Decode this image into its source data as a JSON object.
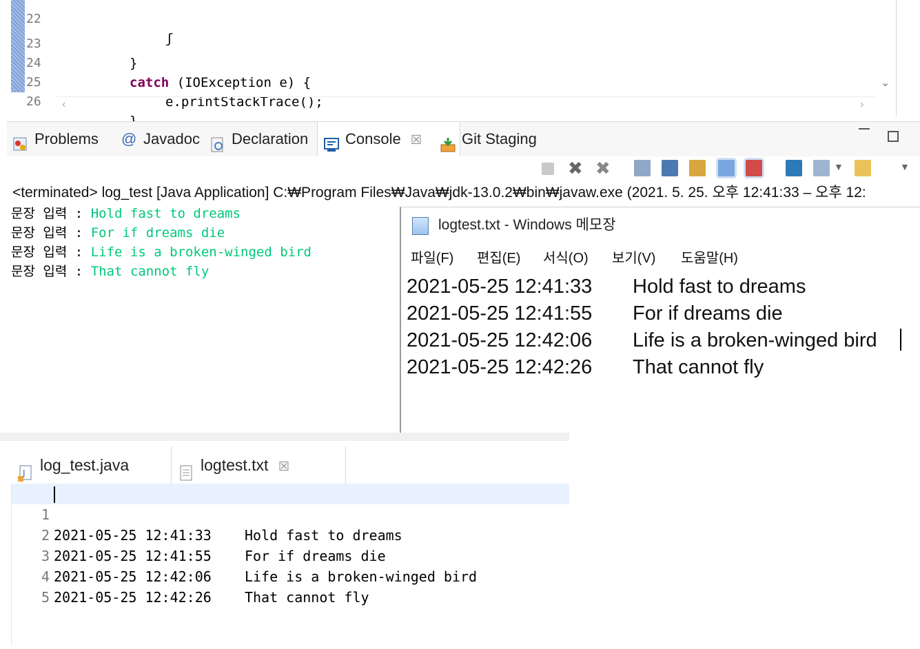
{
  "code_editor": {
    "lines": [
      {
        "num": "22",
        "text": "        }"
      },
      {
        "num": "23",
        "text": "        }"
      },
      {
        "num": "24",
        "kw": "catch",
        "rest": " (IOException e) {"
      },
      {
        "num": "25",
        "text": "            e.printStackTrace();"
      },
      {
        "num": "26",
        "text": "        }"
      }
    ]
  },
  "view_tabs": [
    {
      "label": "Problems",
      "icon": "problems-icon"
    },
    {
      "label": "Javadoc",
      "icon": "javadoc-icon"
    },
    {
      "label": "Declaration",
      "icon": "declaration-icon"
    },
    {
      "label": "Console",
      "icon": "console-icon",
      "active": true,
      "close": "☒"
    },
    {
      "label": "Git Staging",
      "icon": "git-staging-icon"
    }
  ],
  "console": {
    "status": "<terminated> log_test [Java Application] C:₩Program Files₩Java₩jdk-13.0.2₩bin₩javaw.exe  (2021. 5. 25. 오후 12:41:33 – 오후 12:",
    "prompt": "문장 입력 : ",
    "inputs": [
      "Hold fast to dreams",
      "For if dreams die",
      "Life is a broken-winged bird",
      "That cannot fly"
    ]
  },
  "notepad": {
    "title": "logtest.txt - Windows 메모장",
    "menu": [
      "파일(F)",
      "편집(E)",
      "서식(O)",
      "보기(V)",
      "도움말(H)"
    ],
    "lines": [
      {
        "ts": "2021-05-25 12:41:33",
        "text": "Hold fast to dreams"
      },
      {
        "ts": "2021-05-25 12:41:55",
        "text": "For if dreams die"
      },
      {
        "ts": "2021-05-25 12:42:06",
        "text": "Life is a broken-winged bird"
      },
      {
        "ts": "2021-05-25 12:42:26",
        "text": "That cannot fly"
      }
    ]
  },
  "editor_tabs": [
    {
      "label": "log_test.java",
      "icon": "java-file-icon"
    },
    {
      "label": "logtest.txt",
      "icon": "text-file-icon",
      "active": true,
      "close": "☒"
    }
  ],
  "txt_editor": {
    "lines": [
      {
        "num": "1",
        "text": "2021-05-25 12:41:33    Hold fast to dreams"
      },
      {
        "num": "2",
        "text": "2021-05-25 12:41:55    For if dreams die"
      },
      {
        "num": "3",
        "text": "2021-05-25 12:42:06    Life is a broken-winged bird"
      },
      {
        "num": "4",
        "text": "2021-05-25 12:42:26    That cannot fly"
      },
      {
        "num": "5",
        "text": ""
      }
    ]
  },
  "colors": {
    "keyword": "#7f0055",
    "console_input": "#00c87a",
    "current_line": "#e8f2fe"
  }
}
